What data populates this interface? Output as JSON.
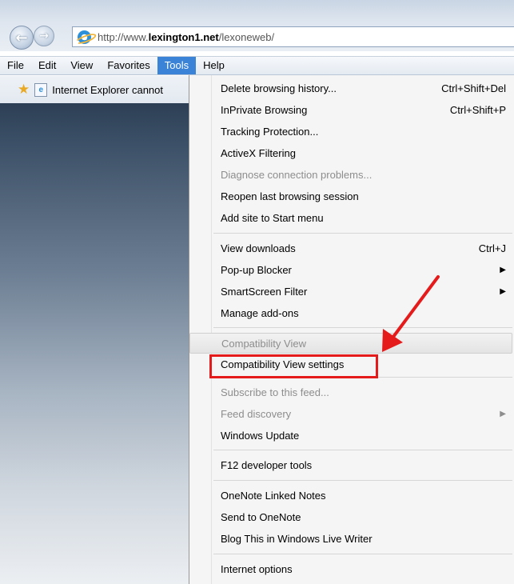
{
  "browser": {
    "url_prefix": "http://www.",
    "url_domain": "lexington1.net",
    "url_path": "/lexoneweb/",
    "menubar": [
      "File",
      "Edit",
      "View",
      "Favorites",
      "Tools",
      "Help"
    ],
    "active_menu": "Tools",
    "tab_label": "Internet Explorer cannot",
    "accent": "#3a83d6"
  },
  "tools_menu": {
    "items": [
      {
        "label": "Delete browsing history...",
        "shortcut": "Ctrl+Shift+Del"
      },
      {
        "label": "InPrivate Browsing",
        "shortcut": "Ctrl+Shift+P"
      },
      {
        "label": "Tracking Protection..."
      },
      {
        "label": "ActiveX Filtering"
      },
      {
        "label": "Diagnose connection problems...",
        "disabled": true
      },
      {
        "label": "Reopen last browsing session"
      },
      {
        "label": "Add site to Start menu"
      },
      {
        "label": "View downloads",
        "shortcut": "Ctrl+J"
      },
      {
        "label": "Pop-up Blocker",
        "submenu": true
      },
      {
        "label": "SmartScreen Filter",
        "submenu": true
      },
      {
        "label": "Manage add-ons"
      },
      {
        "label": "Compatibility View",
        "disabled": true
      },
      {
        "label": "Compatibility View settings",
        "highlighted": true
      },
      {
        "label": "Subscribe to this feed...",
        "disabled": true
      },
      {
        "label": "Feed discovery",
        "disabled": true,
        "submenu": true
      },
      {
        "label": "Windows Update"
      },
      {
        "label": "F12 developer tools"
      },
      {
        "label": "OneNote Linked Notes"
      },
      {
        "label": "Send to OneNote"
      },
      {
        "label": "Blog This in Windows Live Writer"
      },
      {
        "label": "Internet options"
      }
    ]
  },
  "annotation_color": "#e51b1b"
}
